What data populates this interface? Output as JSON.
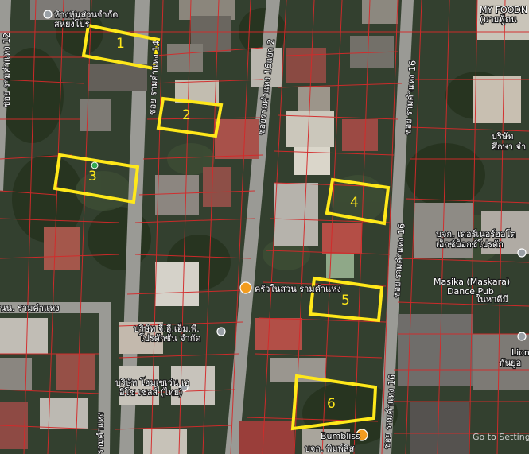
{
  "places": {
    "p1": "ห้างหุ้นส่วนจำกัด",
    "p1b": "สหยงโปร",
    "p2": "MY FOODN",
    "p2b": "(มายฟู้ดน",
    "p3": "บริษัท",
    "p3b": "ศึกษา จำ",
    "p4": "บจก. เดอร์เนอร์ฮอโต",
    "p4b": "เอ็กซ์บ็อกซ์โปรดัก",
    "p5": "Masika (Maskara)",
    "p5b": "Dance Pub",
    "p5c": "ในหาดีมี",
    "p6": "ครัวในสวน รามคำแหง",
    "p7": "บริษัท จี.อี.เอ็ม.พี.",
    "p7b": "โปรดักชั่น จำกัด",
    "p8": "บริษัท โฮมเซเว่น เอ",
    "p8b": "อิโซ เซลส์ (ไทย)",
    "p9": "Lion",
    "p9b": "กันยูอ",
    "p10": "Bumbliss",
    "p11": "บจก. พิมพ์ลิส",
    "p12": "Go to Settings"
  },
  "roads": {
    "r1": "ซอย รามคำแหง 12",
    "r2": "ซอย รามคำแหง 14",
    "r3": "ซอยรามคำแหง 16แยก 2",
    "r4": "ซอย รามคำแหง 16",
    "r5": "ซอย รามคำแหง 16",
    "r6": "ซอย รามคำแหง 16",
    "r7": "นน. รามคำแหง",
    "r8": "รามคำแหง"
  },
  "parcels": [
    {
      "label": "1"
    },
    {
      "label": "2"
    },
    {
      "label": "3"
    },
    {
      "label": "4"
    },
    {
      "label": "5"
    },
    {
      "label": "6"
    }
  ],
  "colors": {
    "parcel_outline": "#ffe81a",
    "parcel_grid": "#d42a2a"
  }
}
